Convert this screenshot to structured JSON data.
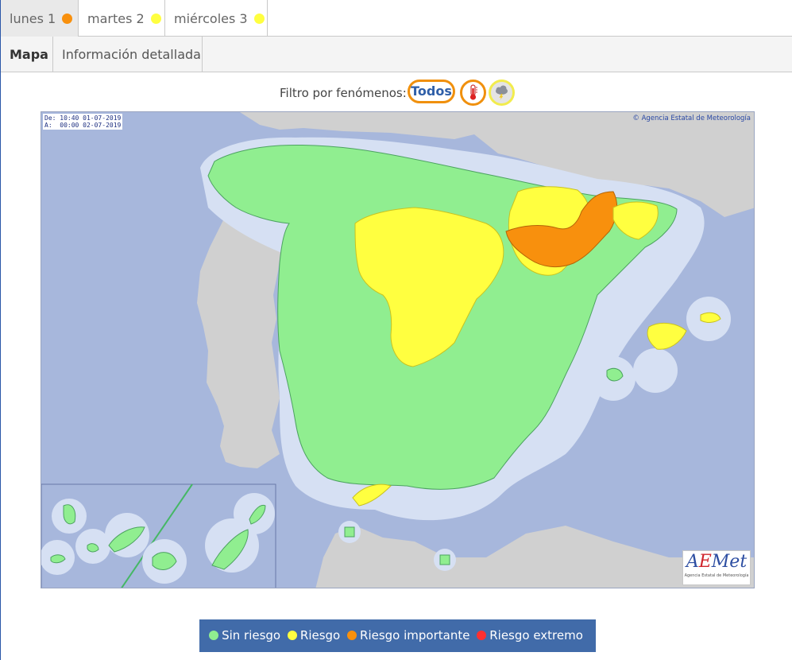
{
  "colors": {
    "green": "#90ee90",
    "yellow": "#ffff40",
    "orange": "#f8900d",
    "red": "#ff3030",
    "sea": "#a7b7dc",
    "land_foreign": "#d0d0d0",
    "accent_blue": "#416ba9"
  },
  "day_tabs": [
    {
      "label": "lunes 1",
      "dot": "orange",
      "active": true
    },
    {
      "label": "martes 2",
      "dot": "yellow",
      "active": false
    },
    {
      "label": "miércoles 3",
      "dot": "yellow",
      "active": false
    }
  ],
  "view_tabs": [
    {
      "label": "Mapa",
      "active": true
    },
    {
      "label": "Información detallada",
      "active": false
    }
  ],
  "filter": {
    "label": "Filtro por fenómenos:",
    "all": "Todos",
    "icons": [
      {
        "name": "thermometer-icon"
      },
      {
        "name": "storm-cloud-icon"
      }
    ]
  },
  "map": {
    "valid_from": "De: 10:40 01-07-2019",
    "valid_to": "A:  00:00 02-07-2019",
    "credit": "© Agencia Estatal de Meteorología",
    "logo": {
      "text_a": "A",
      "text_e": "E",
      "text_rest": "Met",
      "subtitle": "Agencia Estatal de Meteorología"
    }
  },
  "legend": [
    {
      "label": "Sin riesgo",
      "color": "green"
    },
    {
      "label": "Riesgo",
      "color": "yellow"
    },
    {
      "label": "Riesgo importante",
      "color": "orange"
    },
    {
      "label": "Riesgo extremo",
      "color": "red"
    }
  ]
}
